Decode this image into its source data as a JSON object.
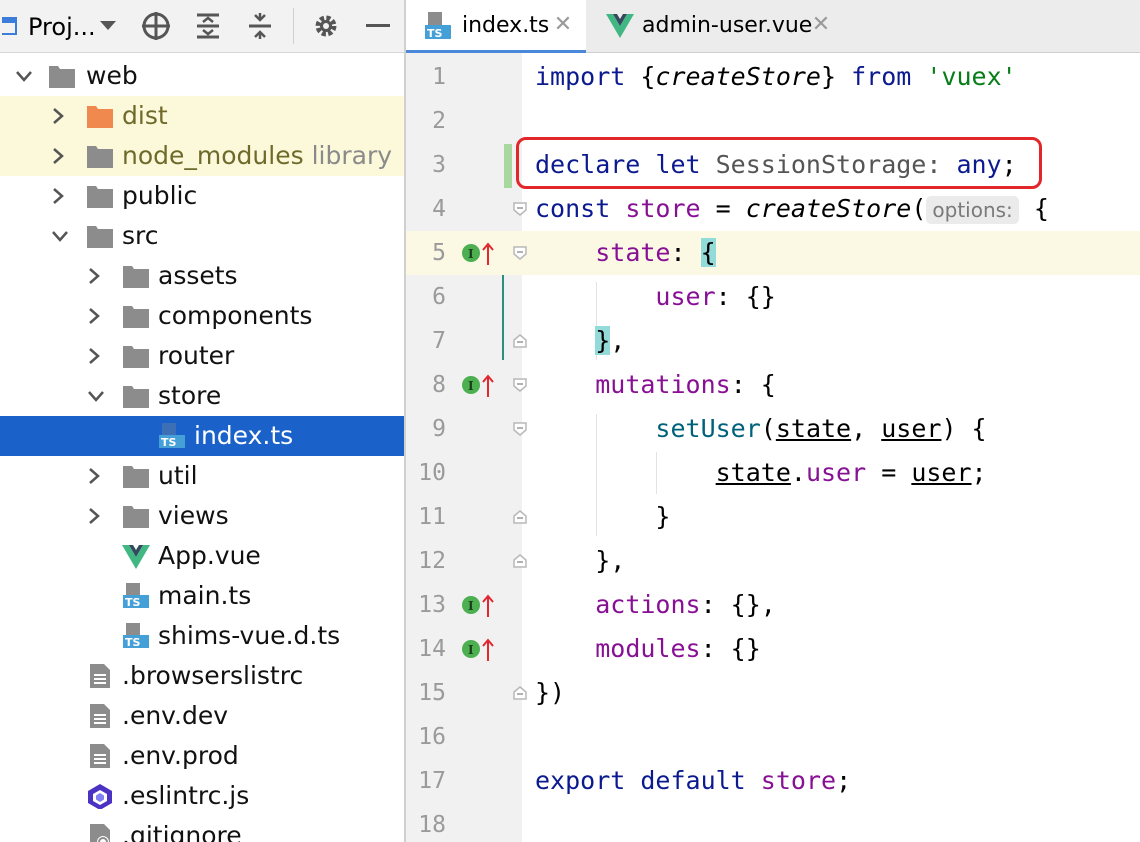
{
  "project_panel": {
    "title": "Proj...",
    "tree": [
      {
        "label": "web",
        "suffix": ""
      },
      {
        "label": "dist",
        "suffix": ""
      },
      {
        "label": "node_modules",
        "suffix": "library"
      },
      {
        "label": "public",
        "suffix": ""
      },
      {
        "label": "src",
        "suffix": ""
      },
      {
        "label": "assets",
        "suffix": ""
      },
      {
        "label": "components",
        "suffix": ""
      },
      {
        "label": "router",
        "suffix": ""
      },
      {
        "label": "store",
        "suffix": ""
      },
      {
        "label": "index.ts",
        "suffix": ""
      },
      {
        "label": "util",
        "suffix": ""
      },
      {
        "label": "views",
        "suffix": ""
      },
      {
        "label": "App.vue",
        "suffix": ""
      },
      {
        "label": "main.ts",
        "suffix": ""
      },
      {
        "label": "shims-vue.d.ts",
        "suffix": ""
      },
      {
        "label": ".browserslistrc",
        "suffix": ""
      },
      {
        "label": ".env.dev",
        "suffix": ""
      },
      {
        "label": ".env.prod",
        "suffix": ""
      },
      {
        "label": ".eslintrc.js",
        "suffix": ""
      },
      {
        "label": ".gitignore",
        "suffix": ""
      }
    ]
  },
  "editor": {
    "tabs": [
      {
        "label": "index.ts",
        "icon_text": "TS"
      },
      {
        "label": "admin-user.vue",
        "icon_text": ""
      }
    ],
    "line_numbers": [
      "1",
      "2",
      "3",
      "4",
      "5",
      "6",
      "7",
      "8",
      "9",
      "10",
      "11",
      "12",
      "13",
      "14",
      "15",
      "16",
      "17",
      "18"
    ],
    "code": {
      "l1": {
        "a": "import",
        "b": " {",
        "c": "createStore",
        "d": "} ",
        "e": "from",
        "f": " ",
        "g": "'vuex'"
      },
      "l3": {
        "a": "declare",
        "b": " ",
        "c": "let",
        "d": " SessionStorage: ",
        "e": "any",
        "f": ";"
      },
      "l4": {
        "a": "const",
        "b": " ",
        "c": "store",
        "d": " = ",
        "e": "createStore",
        "f": "(",
        "hint": "options:",
        "g": " {"
      },
      "l5": {
        "a": "state",
        "b": ": ",
        "c": "{"
      },
      "l6": {
        "a": "user",
        "b": ": {}"
      },
      "l7": {
        "a": "}",
        "b": ","
      },
      "l8": {
        "a": "mutations",
        "b": ": {"
      },
      "l9": {
        "a": "setUser",
        "b": "(",
        "c": "state",
        "d": ", ",
        "e": "user",
        "f": ") {"
      },
      "l10": {
        "a": "state",
        "b": ".",
        "c": "user",
        "d": " = ",
        "e": "user",
        "f": ";"
      },
      "l11": {
        "a": "}"
      },
      "l12": {
        "a": "},"
      },
      "l13": {
        "a": "actions",
        "b": ": {},"
      },
      "l14": {
        "a": "modules",
        "b": ": {}"
      },
      "l15": {
        "a": "})"
      },
      "l17": {
        "a": "export",
        "b": " ",
        "c": "default",
        "d": " ",
        "e": "store",
        "f": ";"
      }
    },
    "implement_marker_letter": "I"
  },
  "colors": {
    "selection": "#1a62c9",
    "keyword": "#0b1a8e",
    "property": "#871094",
    "string": "#067d17",
    "highlight_box": "#e3262a",
    "folder": "#8c8c8c",
    "excluded_folder": "#f0894d",
    "vue": "#41b883"
  }
}
